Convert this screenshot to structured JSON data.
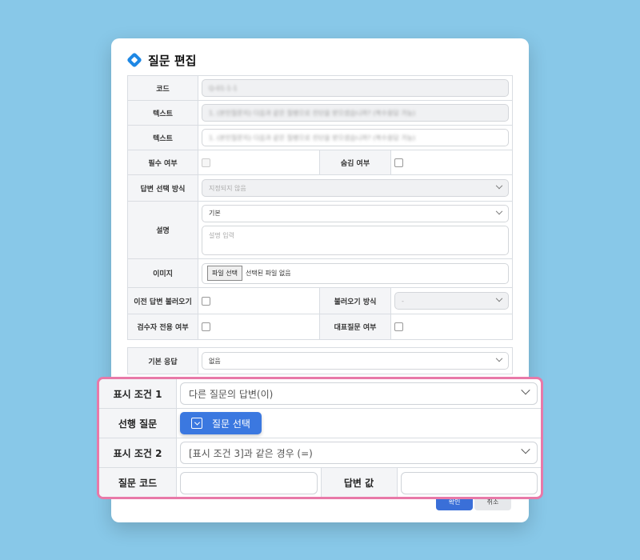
{
  "dialog": {
    "title": "질문 편집",
    "fields": {
      "code_label": "코드",
      "code_value": "Q-01-1-1",
      "text1_label": "텍스트",
      "text1_value": "1. (본인질문지) 다음과 같은 질병으로 진단을 받으셨습니까? (복수응답 가능)",
      "text2_label": "텍스트",
      "text2_value": "1. (본인질문지) 다음과 같은 질병으로 진단을 받으셨습니까? (복수응답 가능)",
      "required_label": "필수 여부",
      "hidden_label": "숨김 여부",
      "answer_method_label": "답변 선택 방식",
      "answer_method_value": "지정되지 않음",
      "description_label": "설명",
      "description_select": "기본",
      "description_placeholder": "설명 입력",
      "image_label": "이미지",
      "file_button": "파일 선택",
      "file_status": "선택된 파일 없음",
      "import_prev_label": "이전 답변 불러오기",
      "import_method_label": "불러오기 방식",
      "import_method_value": "-",
      "reviewer_only_label": "검수자 전용 여부",
      "representative_label": "대표질문 여부",
      "default_answer_label": "기본 응답",
      "default_answer_value": "없음"
    },
    "footer": {
      "confirm": "확인",
      "cancel": "취소"
    }
  },
  "highlight": {
    "condition1_label": "표시 조건 1",
    "condition1_value": "다른 질문의 답변(이)",
    "prev_question_label": "선행 질문",
    "select_question_button": "질문 선택",
    "condition2_label": "표시 조건 2",
    "condition2_value": "[표시 조건 3]과 같은 경우 (=)",
    "question_code_label": "질문 코드",
    "question_code_value": "",
    "answer_value_label": "답변 값",
    "answer_value_value": ""
  },
  "colors": {
    "background": "#88c8e8",
    "accent": "#3b78e0",
    "highlight_border": "#e879a8"
  }
}
